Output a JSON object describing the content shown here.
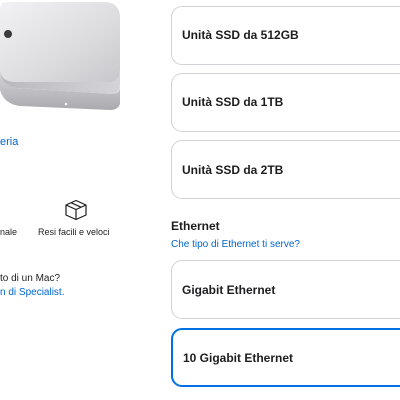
{
  "left": {
    "gallery_link": "eria",
    "features": {
      "left_label": "nale",
      "right_label": "Resi facili e veloci",
      "right_icon": "box-icon"
    },
    "help": {
      "question": "to di un Mac?",
      "link": "n di Specialist."
    }
  },
  "storage": {
    "options": [
      {
        "label": "Unità SSD da 512GB",
        "selected": false
      },
      {
        "label": "Unità SSD da 1TB",
        "selected": false
      },
      {
        "label": "Unità SSD da 2TB",
        "selected": false
      }
    ]
  },
  "ethernet": {
    "title": "Ethernet",
    "help_link": "Che tipo di Ethernet ti serve?",
    "options": [
      {
        "label": "Gigabit Ethernet",
        "selected": false
      },
      {
        "label": "10 Gigabit Ethernet",
        "selected": true
      }
    ]
  },
  "colors": {
    "link": "#0066cc",
    "selected_border": "#0071e3",
    "card_border": "#d2d2d7",
    "text": "#1d1d1f"
  }
}
